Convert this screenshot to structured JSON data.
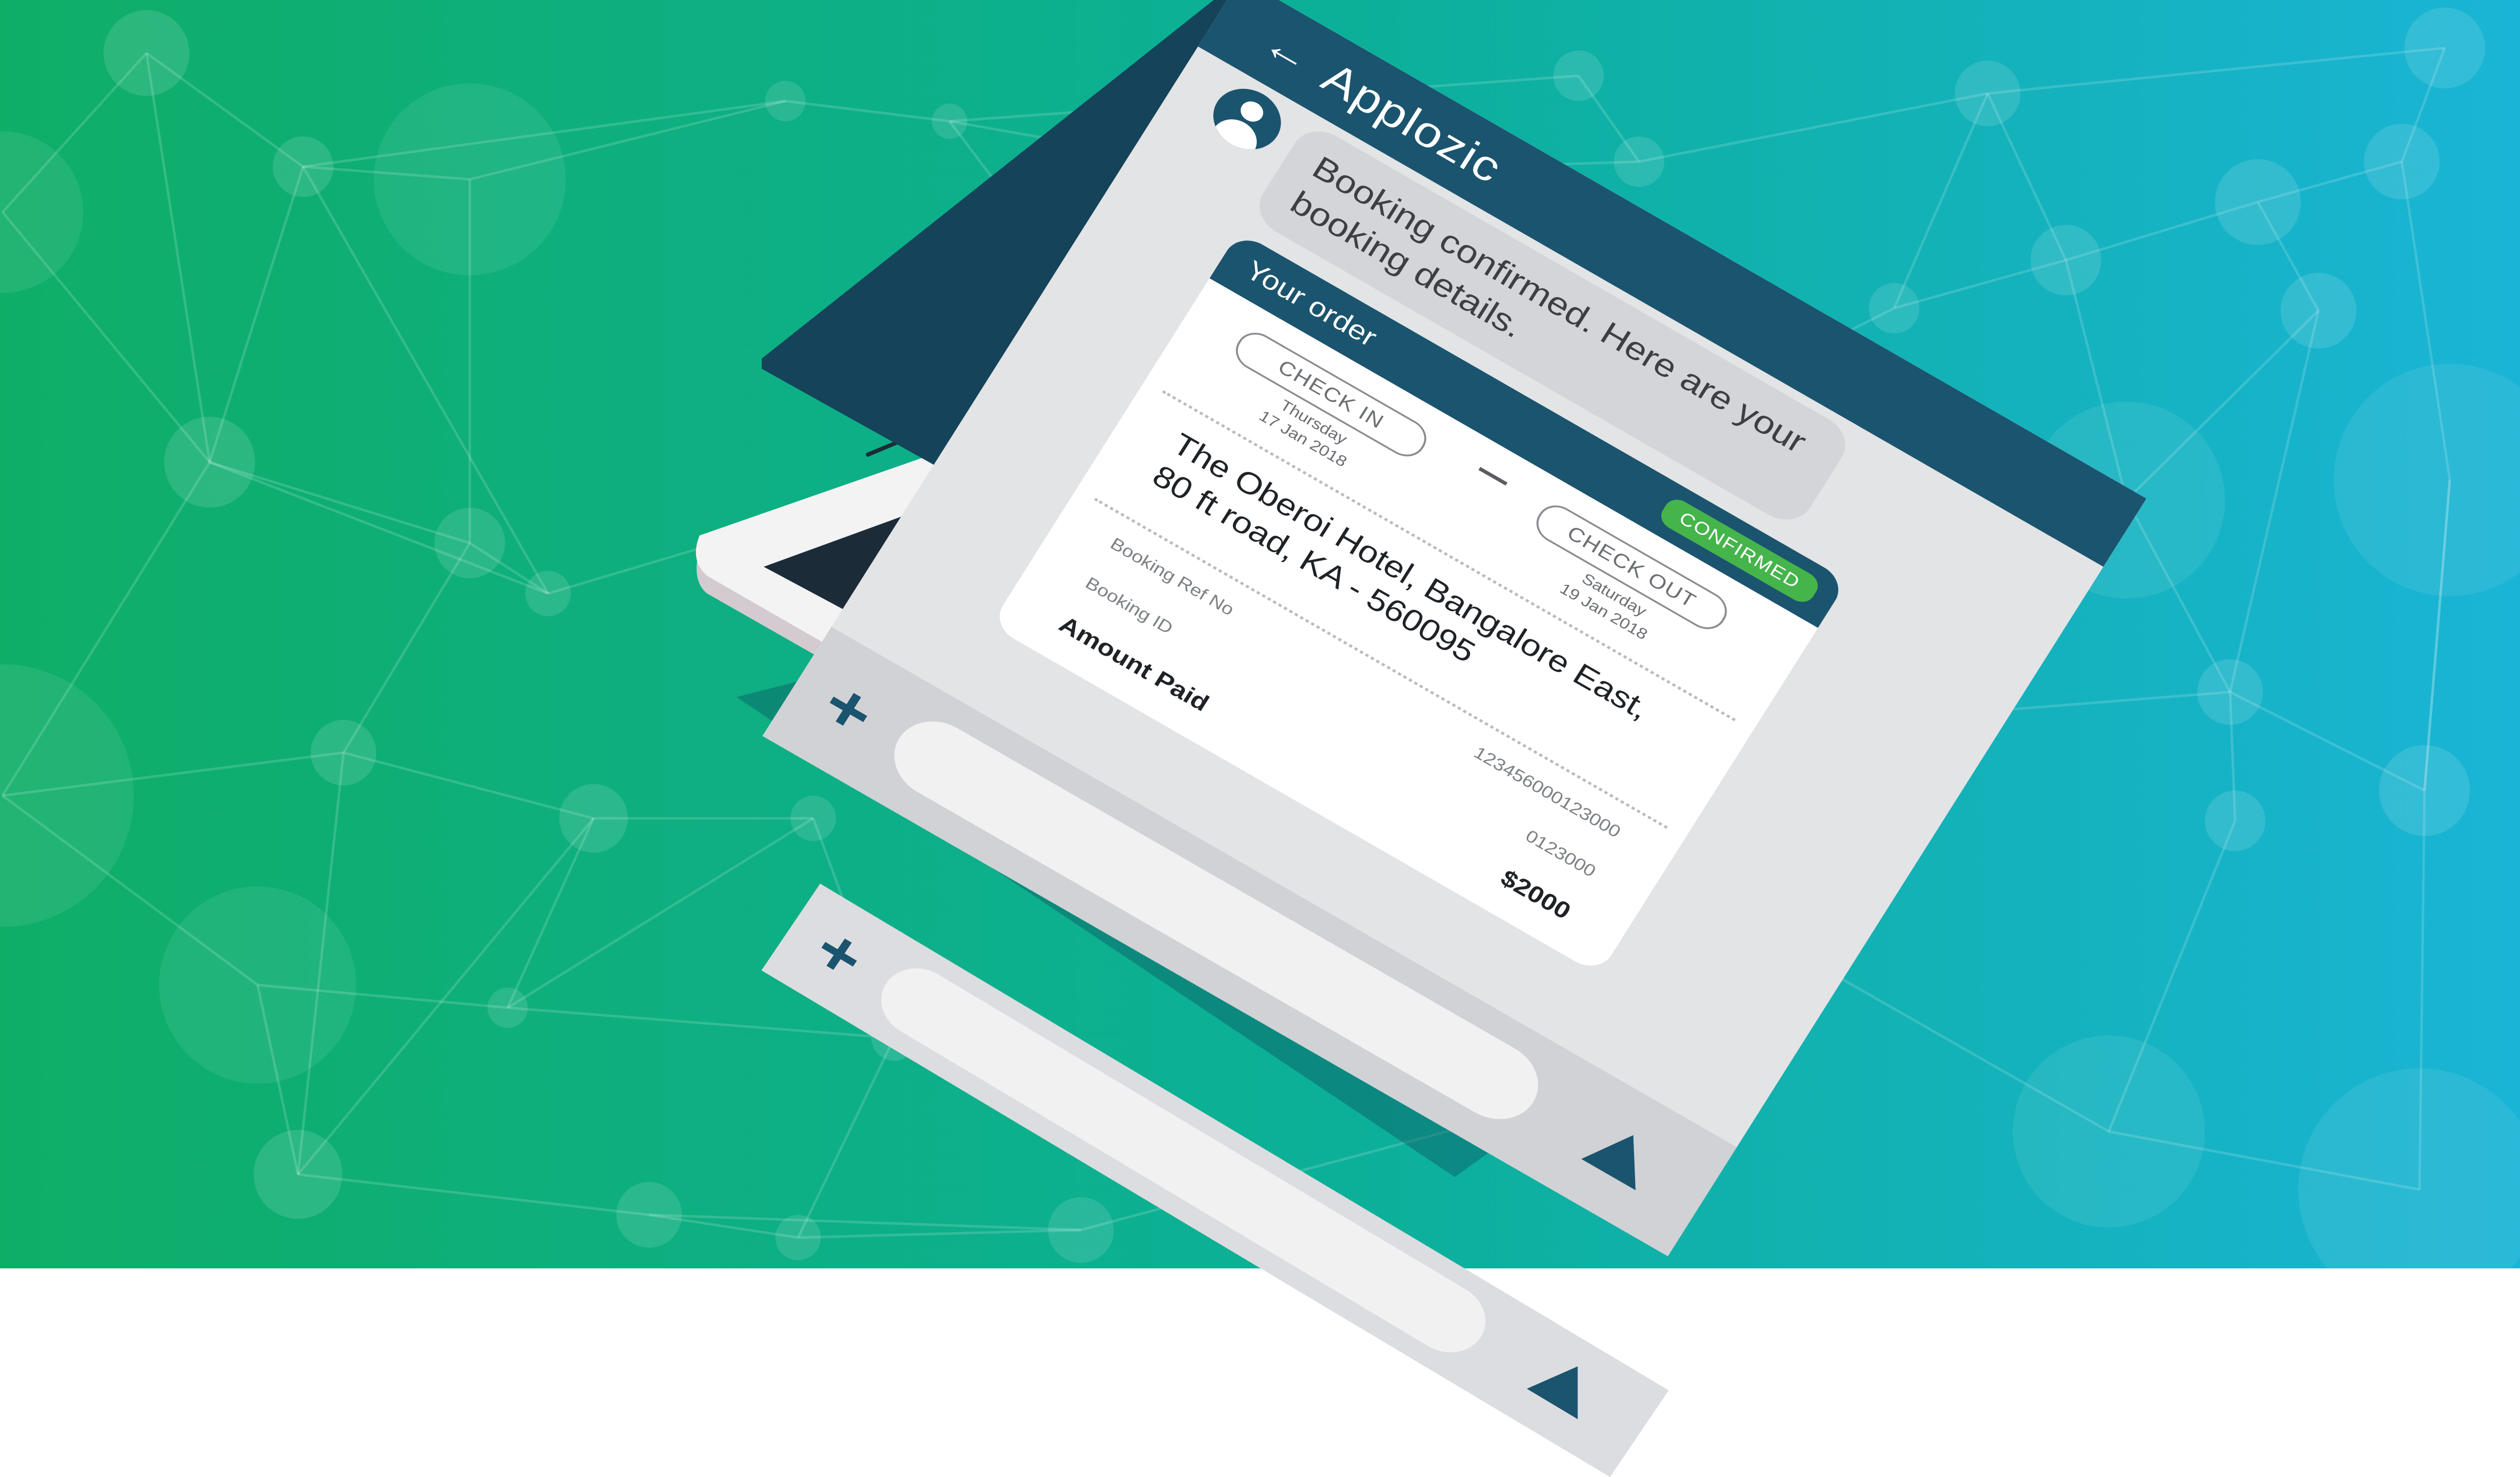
{
  "app": {
    "title": "Applozic",
    "back_icon": "arrow-left-icon"
  },
  "colors": {
    "background_gradient_start": "#0fae67",
    "background_gradient_end": "#1ab4d6",
    "titlebar": "#1b546e",
    "confirmed_badge": "#45b44b",
    "screen_bg": "#e3e4e6"
  },
  "chat": {
    "avatar_icon": "user-avatar-icon",
    "message": "Booking confirmed. Here are your booking details."
  },
  "order": {
    "label": "Your order",
    "status": "CONFIRMED",
    "check_in": {
      "label": "CHECK IN",
      "day": "Thursday",
      "date": "17 Jan 2018"
    },
    "check_out": {
      "label": "CHECK OUT",
      "day": "Saturday",
      "date": "19 Jan 2018"
    },
    "hotel_address": "The Oberoi Hotel, Bangalore East, 80 ft road, KA - 560095",
    "booking_ref": {
      "label": "Booking Ref No",
      "value": "123456000123000"
    },
    "booking_id": {
      "label": "Booking ID",
      "value": "0123000"
    },
    "amount": {
      "label": "Amount Paid",
      "value": "$2000"
    }
  },
  "composer": {
    "plus_icon": "plus-icon",
    "send_icon": "send-icon"
  }
}
